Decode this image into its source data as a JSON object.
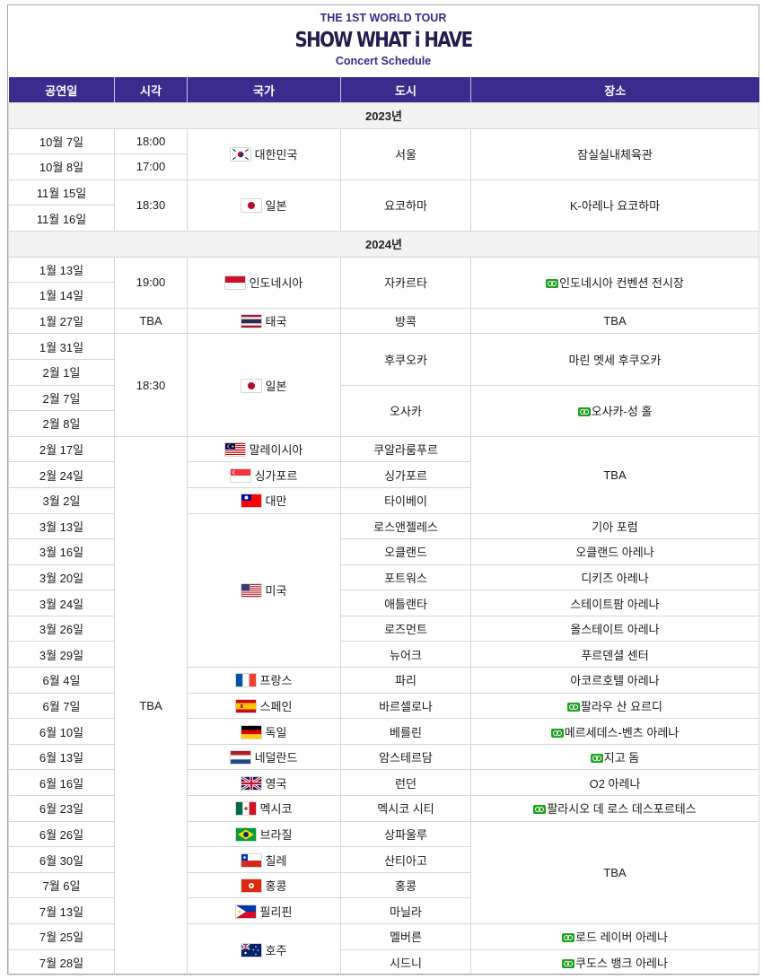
{
  "header": {
    "tour_title": "THE 1ST WORLD TOUR",
    "logo_text": "SHOW WHAT i HAVE",
    "subtitle": "Concert Schedule"
  },
  "columns": [
    "공연일",
    "시각",
    "국가",
    "도시",
    "장소"
  ],
  "years": {
    "y2023": "2023년",
    "y2024": "2024년"
  },
  "dates": {
    "d1": "10월 7일",
    "d2": "10월 8일",
    "d3": "11월 15일",
    "d4": "11월 16일",
    "d5": "1월 13일",
    "d6": "1월 14일",
    "d7": "1월 27일",
    "d8": "1월 31일",
    "d9": "2월 1일",
    "d10": "2월 7일",
    "d11": "2월 8일",
    "d12": "2월 17일",
    "d13": "2월 24일",
    "d14": "3월 2일",
    "d15": "3월 13일",
    "d16": "3월 16일",
    "d17": "3월 20일",
    "d18": "3월 24일",
    "d19": "3월 26일",
    "d20": "3월 29일",
    "d21": "6월 4일",
    "d22": "6월 7일",
    "d23": "6월 10일",
    "d24": "6월 13일",
    "d25": "6월 16일",
    "d26": "6월 23일",
    "d27": "6월 26일",
    "d28": "6월 30일",
    "d29": "7월 6일",
    "d30": "7월 13일",
    "d31": "7월 25일",
    "d32": "7월 28일"
  },
  "times": {
    "t1": "18:00",
    "t2": "17:00",
    "t3": "18:30",
    "t4": "19:00",
    "t5": "TBA",
    "t6": "18:30",
    "t7": "TBA"
  },
  "countries": {
    "korea": "대한민국",
    "japan1": "일본",
    "indonesia": "인도네시아",
    "thailand": "태국",
    "japan2": "일본",
    "malaysia": "말레이시아",
    "singapore": "싱가포르",
    "taiwan": "대만",
    "usa": "미국",
    "france": "프랑스",
    "spain": "스페인",
    "germany": "독일",
    "netherlands": "네덜란드",
    "uk": "영국",
    "mexico": "멕시코",
    "brazil": "브라질",
    "chile": "칠레",
    "hongkong": "홍콩",
    "philippines": "필리핀",
    "australia": "호주"
  },
  "cities": {
    "c1": "서울",
    "c2": "요코하마",
    "c3": "자카르타",
    "c4": "방콕",
    "c5": "후쿠오카",
    "c6": "오사카",
    "c7": "쿠알라룸푸르",
    "c8": "싱가포르",
    "c9": "타이베이",
    "c10": "로스앤젤레스",
    "c11": "오클랜드",
    "c12": "포트워스",
    "c13": "애틀랜타",
    "c14": "로즈먼트",
    "c15": "뉴어크",
    "c16": "파리",
    "c17": "바르셀로나",
    "c18": "베를린",
    "c19": "암스테르담",
    "c20": "런던",
    "c21": "멕시코 시티",
    "c22": "상파울루",
    "c23": "산티아고",
    "c24": "홍콩",
    "c25": "마닐라",
    "c26": "멜버른",
    "c27": "시드니"
  },
  "venues": {
    "v1": "잠실실내체육관",
    "v2": "K-아레나 요코하마",
    "v3": "인도네시아 컨벤션 전시장",
    "v4": "TBA",
    "v5": "마린 멧세 후쿠오카",
    "v6": "오사카-성 홀",
    "v7": "TBA",
    "v8": "기아 포럼",
    "v9": "오클랜드 아레나",
    "v10": "디키즈 아레나",
    "v11": "스테이트팜 아레나",
    "v12": "올스테이트 아레나",
    "v13": "푸르덴셜 센터",
    "v14": "아코르호텔 아레나",
    "v15": "팔라우 산 요르디",
    "v16": "메르세데스-벤츠 아레나",
    "v17": "지고 돔",
    "v18": "O2 아레나",
    "v19": "팔라시오 데 로스 데스포르테스",
    "v20": "TBA",
    "v21": "로드 레이버 아레나",
    "v22": "쿠도스 뱅크 아레나"
  },
  "colors": {
    "header_bg": "#3a2b8c",
    "link": "#2673c6",
    "external_link": "#1f8c1f",
    "year_bg": "#f2f2f2"
  }
}
